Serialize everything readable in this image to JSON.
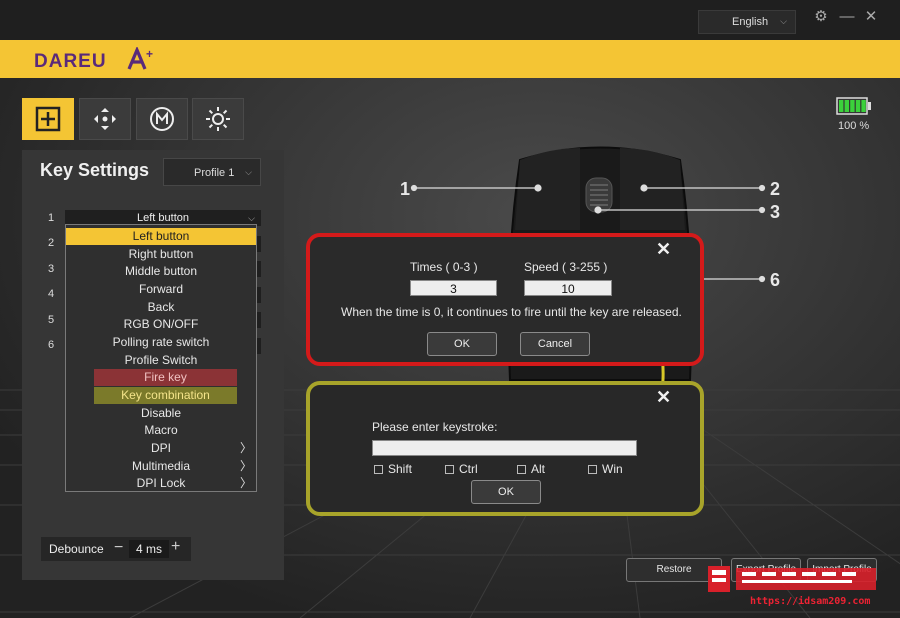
{
  "window": {
    "language": "English",
    "settings_icon": "gear-icon",
    "minimize_icon": "minimize-icon",
    "close_icon": "close-icon"
  },
  "brand": {
    "name": "DAREU",
    "mark": "A+",
    "color": "#f4c534"
  },
  "toolbar": {
    "tabs": [
      {
        "icon": "plus-square-icon",
        "active": true
      },
      {
        "icon": "move-arrows-icon",
        "active": false
      },
      {
        "icon": "macro-m-icon",
        "active": false
      },
      {
        "icon": "light-sun-icon",
        "active": false
      }
    ]
  },
  "battery": {
    "percent_text": "100 %",
    "level": 1.0,
    "color": "#3bd13b"
  },
  "key_settings": {
    "title": "Key Settings",
    "profile": "Profile 1",
    "rows": [
      {
        "num": "1",
        "value": "Left button"
      },
      {
        "num": "2",
        "value": ""
      },
      {
        "num": "3",
        "value": ""
      },
      {
        "num": "4",
        "value": ""
      },
      {
        "num": "5",
        "value": ""
      },
      {
        "num": "6",
        "value": ""
      }
    ],
    "dropdown": [
      "Left button",
      "Right button",
      "Middle button",
      "Forward",
      "Back",
      "RGB ON/OFF",
      "Polling rate switch",
      "Profile Switch",
      "Fire key",
      "Key combination",
      "Disable",
      "Macro",
      "DPI",
      "Multimedia",
      "DPI Lock"
    ],
    "debounce": {
      "label": "Debounce",
      "value": "4 ms",
      "minus": "−",
      "plus": "+"
    }
  },
  "callouts": [
    "1",
    "2",
    "3",
    "6"
  ],
  "fire_dialog": {
    "times_label": "Times ( 0-3 )",
    "times_value": "3",
    "speed_label": "Speed ( 3-255 )",
    "speed_value": "10",
    "note": "When the time is 0, it continues to fire until the key are released.",
    "ok": "OK",
    "cancel": "Cancel",
    "close": "✕",
    "border_color": "#d41a1a"
  },
  "combo_dialog": {
    "prompt": "Please enter keystroke:",
    "keystroke_value": "",
    "modifiers": [
      "Shift",
      "Ctrl",
      "Alt",
      "Win"
    ],
    "ok": "OK",
    "close": "✕",
    "border_color": "#a8a42a"
  },
  "footer": {
    "restore": "Restore",
    "export": "Export Profile",
    "import": "Import Profile"
  },
  "watermark": {
    "url": "https://idsam209.com"
  }
}
